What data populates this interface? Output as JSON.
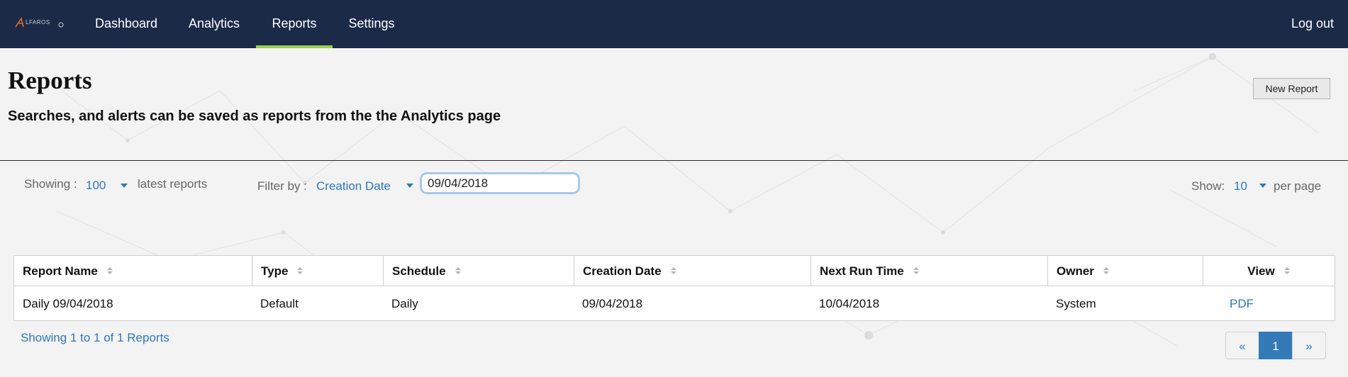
{
  "nav": {
    "logo_text": "LFAROS",
    "items": [
      {
        "label": "Dashboard"
      },
      {
        "label": "Analytics"
      },
      {
        "label": "Reports"
      },
      {
        "label": "Settings"
      }
    ],
    "active": "Reports",
    "logout_label": "Log out",
    "accent_color": "#9bcf4a",
    "background_color": "#1b2a47"
  },
  "header": {
    "title": "Reports",
    "subtitle": "Searches, and alerts can be saved as reports from the the Analytics page",
    "new_report_label": "New Report"
  },
  "controls": {
    "showing_label": "Showing :",
    "showing_value": "100",
    "showing_suffix": "latest reports",
    "filter_label": "Filter by :",
    "filter_value": "Creation Date",
    "filter_input_value": "09/04/2018",
    "show_label": "Show:",
    "show_value": "10",
    "show_suffix": "per page"
  },
  "table": {
    "columns": [
      "Report Name",
      "Type",
      "Schedule",
      "Creation Date",
      "Next Run Time",
      "Owner",
      "View"
    ],
    "rows": [
      {
        "report_name": "Daily 09/04/2018",
        "type": "Default",
        "schedule": "Daily",
        "creation_date": "09/04/2018",
        "next_run_time": "10/04/2018",
        "owner": "System",
        "view": "PDF"
      }
    ],
    "summary": "Showing 1 to 1 of 1 Reports"
  },
  "pagination": {
    "prev_label": "«",
    "current_page": "1",
    "next_label": "»"
  },
  "icons": {
    "sort": "sort-icon",
    "dropdown": "chevron-down-icon",
    "logo": "alfaros-logo-icon"
  },
  "colors": {
    "link": "#2f78b8",
    "active_page": "#337ab7"
  }
}
